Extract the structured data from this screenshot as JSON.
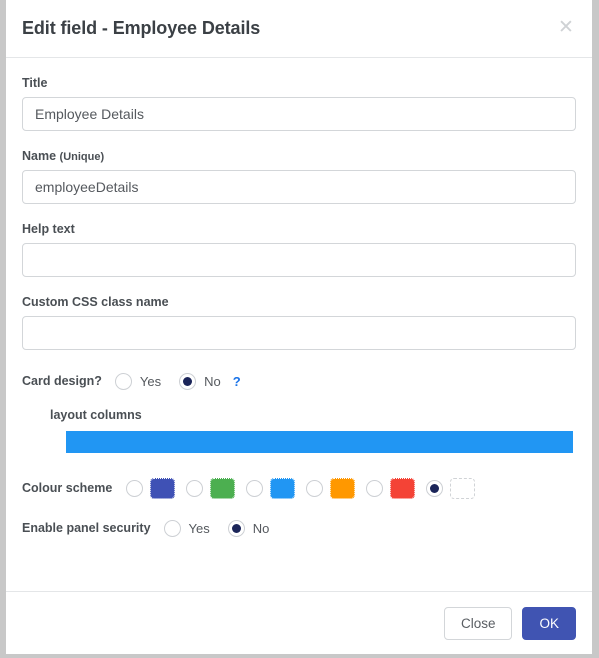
{
  "dialog": {
    "title": "Edit field - Employee Details",
    "close_icon": "close-icon",
    "close_glyph": "✕"
  },
  "form": {
    "title_field": {
      "label": "Title",
      "value": "Employee Details",
      "placeholder": ""
    },
    "name_field": {
      "label": "Name",
      "label_suffix": "(Unique)",
      "value": "employeeDetails",
      "placeholder": ""
    },
    "help_text_field": {
      "label": "Help text",
      "value": "",
      "placeholder": ""
    },
    "custom_css_field": {
      "label": "Custom CSS class name",
      "value": "",
      "placeholder": ""
    },
    "card_design": {
      "label": "Card design?",
      "yes_label": "Yes",
      "no_label": "No",
      "selected": "No",
      "help_glyph": "?",
      "help_color": "#1a73e8"
    },
    "layout_columns": {
      "label": "layout columns",
      "bar_color": "#2196f3",
      "columns": 1
    },
    "colour_scheme": {
      "label": "Colour scheme",
      "selected_index": 4,
      "options": [
        {
          "name": "indigo",
          "color": "#3f51b5"
        },
        {
          "name": "green",
          "color": "#4caf50"
        },
        {
          "name": "blue",
          "color": "#2196f3"
        },
        {
          "name": "orange",
          "color": "#ff9800"
        },
        {
          "name": "red",
          "color": "#f44336"
        },
        {
          "name": "none",
          "color": "#ffffff"
        }
      ]
    },
    "panel_security": {
      "label": "Enable panel security",
      "yes_label": "Yes",
      "no_label": "No",
      "selected": "No"
    }
  },
  "footer": {
    "close_label": "Close",
    "ok_label": "OK",
    "primary_color": "#4054b2"
  }
}
